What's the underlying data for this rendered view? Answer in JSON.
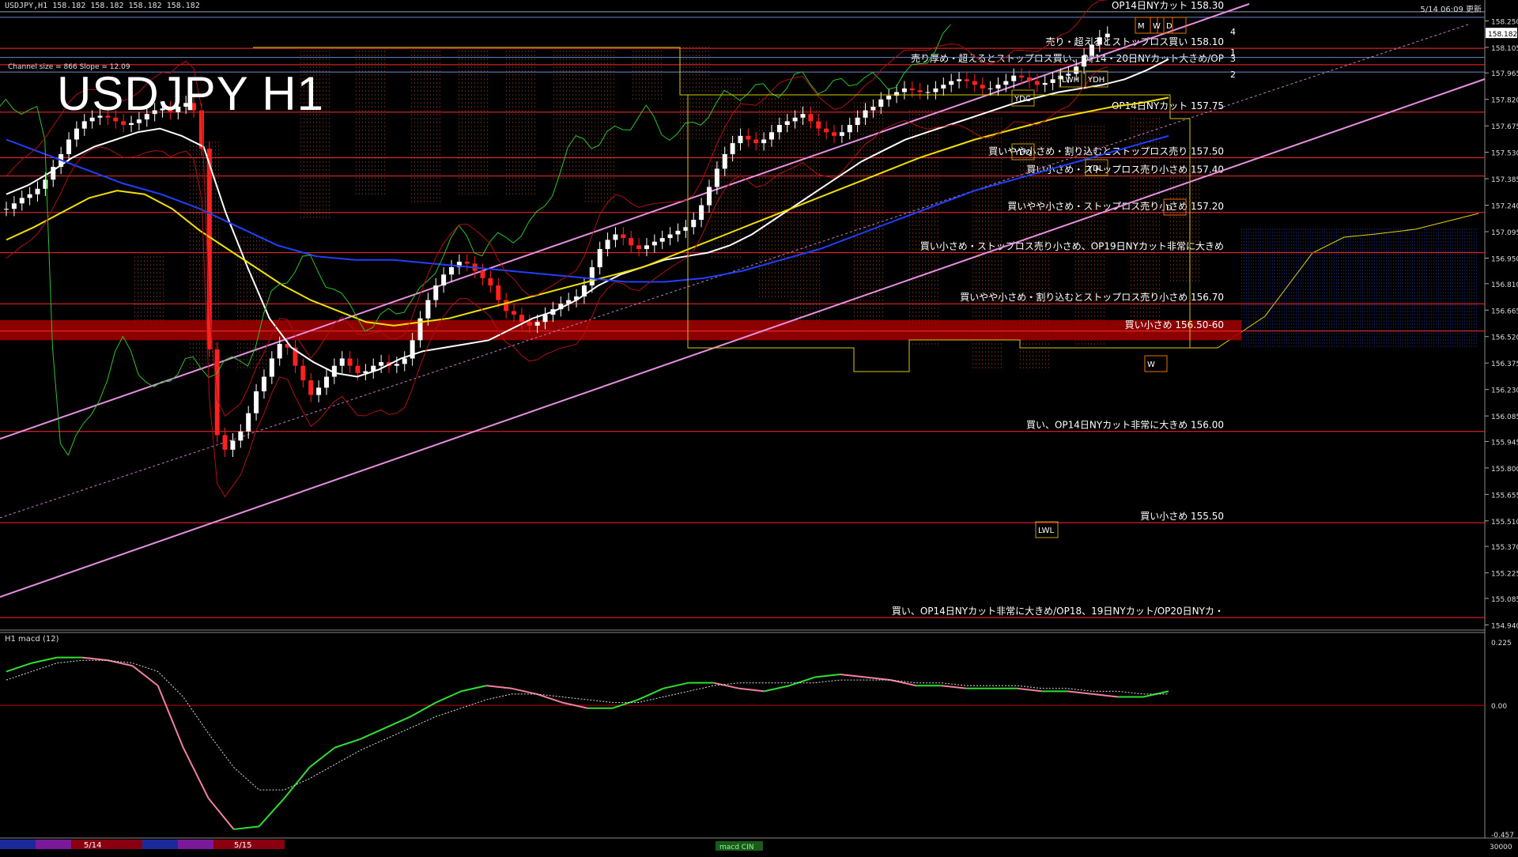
{
  "header": {
    "symbol_info": "USDJPY,H1  158.182 158.182 158.182 158.182",
    "timestamp": "5/14 06:09 更新",
    "big_title": "USDJPY H1",
    "channel_info": "Channel size = 866 Slope = 12.09"
  },
  "price_axis": {
    "ymin": 154.92,
    "ymax": 158.33,
    "ticks": [
      158.25,
      158.105,
      157.965,
      157.82,
      157.675,
      157.53,
      157.385,
      157.24,
      157.095,
      156.95,
      156.81,
      156.665,
      156.52,
      156.375,
      156.23,
      156.085,
      155.945,
      155.8,
      155.655,
      155.51,
      155.37,
      155.225,
      155.085,
      154.94
    ],
    "current_price": "158.182"
  },
  "levels": [
    {
      "price": 158.3,
      "label": "OP14日NYカット 158.30",
      "color": "#8aa0c8"
    },
    {
      "price": 158.1,
      "label": "売り・超えるとストップロス買い 158.10",
      "color": "#ff2a2a"
    },
    {
      "price": 158.01,
      "label": "売り厚め・超えるとストップロス買い、OP14・20日NYカット大きめ/OP",
      "color": "#ff2a2a"
    },
    {
      "price": 157.75,
      "label": "OP14日NYカット 157.75",
      "color": "#ff2a2a"
    },
    {
      "price": 157.5,
      "label": "買いやや小さめ・割り込むとストップロス売り 157.50",
      "color": "#ff2a2a"
    },
    {
      "price": 157.4,
      "label": "買い小さめ・ストップロス売り小さめ 157.40",
      "color": "#ff2a2a"
    },
    {
      "price": 157.2,
      "label": "買いやや小さめ・ストップロス売り小さめ 157.20",
      "color": "#ff2a2a"
    },
    {
      "price": 156.98,
      "label": "買い小さめ・ストップロス売り小さめ、OP19日NYカット非常に大きめ",
      "color": "#ff2a2a"
    },
    {
      "price": 156.7,
      "label": "買いやや小さめ・割り込むとストップロス売り小さめ 156.70",
      "color": "#ff2a2a"
    },
    {
      "price": 156.55,
      "label": "買い小さめ 156.50-60",
      "color": "#ff2a2a"
    },
    {
      "price": 156.0,
      "label": "買い、OP14日NYカット非常に大きめ 156.00",
      "color": "#ff2a2a"
    },
    {
      "price": 155.5,
      "label": "買い小さめ 155.50",
      "color": "#ff2a2a"
    },
    {
      "price": 154.98,
      "label": "買い、OP14日NYカット非常に大きめ/OP18、19日NYカット/OP20日NYカ・",
      "color": "#ff2a2a"
    }
  ],
  "channel_numbers": [
    "4",
    "1",
    "3",
    "2"
  ],
  "box_labels": [
    "YDC",
    "YDO",
    "LWH",
    "YDH",
    "YDL",
    "LWL",
    "M",
    "W",
    "D",
    "D",
    "W"
  ],
  "macd": {
    "label": "H1  macd (12)",
    "ymin": -0.457,
    "ymax": 0.225,
    "ticks": [
      "0.225",
      "0.00",
      "-0.457"
    ],
    "bottom_value": "30000",
    "macd_line": [
      0.12,
      0.15,
      0.17,
      0.17,
      0.16,
      0.14,
      0.07,
      -0.15,
      -0.33,
      -0.44,
      -0.43,
      -0.33,
      -0.22,
      -0.15,
      -0.12,
      -0.08,
      -0.04,
      0.01,
      0.05,
      0.07,
      0.06,
      0.04,
      0.01,
      -0.01,
      -0.01,
      0.02,
      0.06,
      0.08,
      0.08,
      0.06,
      0.05,
      0.07,
      0.1,
      0.11,
      0.1,
      0.09,
      0.07,
      0.07,
      0.06,
      0.06,
      0.06,
      0.05,
      0.05,
      0.04,
      0.03,
      0.03,
      0.05
    ],
    "signal_line": [
      0.09,
      0.12,
      0.15,
      0.16,
      0.16,
      0.15,
      0.12,
      0.03,
      -0.1,
      -0.22,
      -0.3,
      -0.3,
      -0.26,
      -0.21,
      -0.16,
      -0.12,
      -0.08,
      -0.04,
      -0.01,
      0.02,
      0.04,
      0.04,
      0.03,
      0.02,
      0.01,
      0.01,
      0.03,
      0.05,
      0.07,
      0.08,
      0.08,
      0.08,
      0.08,
      0.09,
      0.09,
      0.09,
      0.08,
      0.08,
      0.07,
      0.07,
      0.07,
      0.06,
      0.06,
      0.05,
      0.05,
      0.04,
      0.04
    ]
  },
  "date_labels": [
    "5/14",
    "5/15"
  ],
  "bottom_tab": "macd CIN",
  "chart_data": {
    "type": "line",
    "title": "USDJPY H1",
    "ylim": [
      154.92,
      158.33
    ],
    "x": [
      0,
      1,
      2,
      3,
      4,
      5,
      6,
      7,
      8,
      9,
      10,
      11,
      12,
      13,
      14,
      15,
      16,
      17,
      18,
      19,
      20,
      21,
      22,
      23,
      24,
      25,
      26,
      27,
      28,
      29,
      30,
      31,
      32,
      33,
      34,
      35,
      36,
      37,
      38,
      39,
      40,
      41,
      42,
      43,
      44,
      45,
      46,
      47,
      48,
      49,
      50,
      51,
      52,
      53,
      54,
      55,
      56,
      57,
      58,
      59,
      60,
      61,
      62,
      63,
      64,
      65,
      66,
      67,
      68,
      69,
      70,
      71,
      72,
      73,
      74,
      75,
      76,
      77,
      78,
      79,
      80,
      81,
      82,
      83,
      84,
      85,
      86,
      87,
      88,
      89,
      90,
      91,
      92,
      93,
      94,
      95,
      96,
      97,
      98,
      99,
      100,
      101,
      102,
      103,
      104,
      105,
      106,
      107,
      108,
      109,
      110,
      111,
      112,
      113,
      114,
      115,
      116,
      117,
      118,
      119,
      120,
      121,
      122,
      123,
      124,
      125,
      126,
      127,
      128,
      129,
      130,
      131,
      132,
      133,
      134,
      135,
      136,
      137,
      138,
      139,
      140,
      141,
      142,
      143,
      144,
      145,
      146,
      147
    ],
    "series": [
      {
        "values": [
          157.22,
          157.25,
          157.28,
          157.3,
          157.33,
          157.38,
          157.45,
          157.52,
          157.6,
          157.66,
          157.7,
          157.72,
          157.73,
          157.72,
          157.7,
          157.68,
          157.69,
          157.71,
          157.74,
          157.76,
          157.77,
          157.75,
          157.78,
          157.8,
          157.76,
          157.55,
          156.45,
          155.98,
          155.9,
          155.95,
          156.0,
          156.1,
          156.22,
          156.3,
          156.4,
          156.48,
          156.46,
          156.36,
          156.28,
          156.2,
          156.24,
          156.3,
          156.36,
          156.4,
          156.36,
          156.32,
          156.33,
          156.36,
          156.38,
          156.36,
          156.37,
          156.4,
          156.5,
          156.62,
          156.72,
          156.8,
          156.86,
          156.9,
          156.93,
          156.92,
          156.88,
          156.84,
          156.8,
          156.72,
          156.66,
          156.64,
          156.6,
          156.58,
          156.6,
          156.64,
          156.67,
          156.7,
          156.72,
          156.74,
          156.8,
          156.9,
          157.0,
          157.05,
          157.08,
          157.06,
          157.02,
          157.0,
          157.02,
          157.04,
          157.06,
          157.08,
          157.1,
          157.12,
          157.16,
          157.24,
          157.34,
          157.44,
          157.52,
          157.58,
          157.62,
          157.6,
          157.58,
          157.6,
          157.64,
          157.68,
          157.7,
          157.72,
          157.74,
          157.7,
          157.66,
          157.64,
          157.62,
          157.64,
          157.68,
          157.72,
          157.76,
          157.78,
          157.82,
          157.84,
          157.86,
          157.88,
          157.87,
          157.86,
          157.86,
          157.88,
          157.9,
          157.92,
          157.93,
          157.92,
          157.9,
          157.88,
          157.88,
          157.9,
          157.92,
          157.95,
          157.94,
          157.92,
          157.9,
          157.91,
          157.93,
          157.95,
          157.96,
          158.0,
          158.06,
          158.12,
          158.16,
          158.18
        ],
        "name": "USDJPY"
      },
      {
        "name": "",
        "values": [
          157.3,
          157.35,
          157.42,
          157.5,
          157.56,
          157.6,
          157.64,
          157.66,
          157.62,
          157.56,
          157.2,
          156.9,
          156.62,
          156.46,
          156.38,
          156.32,
          156.3,
          156.34,
          156.4,
          156.44,
          156.46,
          156.48,
          156.5,
          156.56,
          156.62,
          156.66,
          156.72,
          156.8,
          156.86,
          156.9,
          156.94,
          156.96,
          156.98,
          157.02,
          157.08,
          157.16,
          157.24,
          157.32,
          157.4,
          157.48,
          157.54,
          157.6,
          157.64,
          157.68,
          157.72,
          157.76,
          157.8,
          157.83,
          157.86,
          157.88,
          157.9,
          157.93,
          157.98,
          158.04
        ]
      },
      {
        "name": "",
        "values": [
          157.05,
          157.12,
          157.2,
          157.28,
          157.32,
          157.3,
          157.22,
          157.1,
          157.0,
          156.9,
          156.8,
          156.72,
          156.66,
          156.6,
          156.58,
          156.6,
          156.62,
          156.66,
          156.7,
          156.74,
          156.78,
          156.82,
          156.86,
          156.9,
          156.96,
          157.02,
          157.08,
          157.14,
          157.2,
          157.26,
          157.32,
          157.38,
          157.44,
          157.5,
          157.55,
          157.6,
          157.64,
          157.68,
          157.72,
          157.75,
          157.78,
          157.8,
          157.83
        ]
      },
      {
        "name": "",
        "values": [
          157.6,
          157.52,
          157.44,
          157.36,
          157.3,
          157.22,
          157.12,
          157.02,
          156.96,
          156.94,
          156.94,
          156.92,
          156.9,
          156.88,
          156.86,
          156.84,
          156.82,
          156.82,
          156.84,
          156.88,
          156.94,
          157.0,
          157.08,
          157.16,
          157.24,
          157.32,
          157.38,
          157.44,
          157.5,
          157.56,
          157.62
        ]
      }
    ],
    "levels": [
      158.3,
      158.1,
      158.01,
      157.75,
      157.5,
      157.4,
      157.2,
      156.98,
      156.7,
      156.55,
      156.0,
      155.5,
      154.98
    ]
  }
}
